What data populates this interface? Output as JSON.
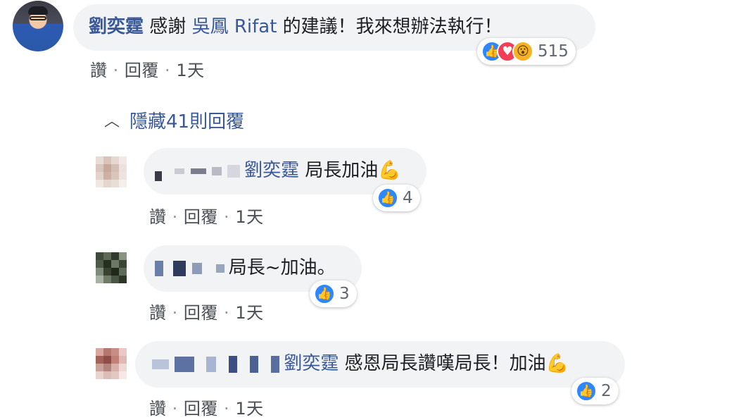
{
  "main_comment": {
    "author": "劉奕霆",
    "text_prefix": "感謝",
    "mention": "吳鳳 Rifat",
    "text_suffix": "的建議！我來想辦法執行！",
    "reactions": {
      "icons": [
        "like-icon",
        "love-icon",
        "wow-icon"
      ],
      "count": "515"
    },
    "actions": {
      "like": "讚",
      "reply": "回覆",
      "time": "1天"
    }
  },
  "hide_replies": {
    "label": "隱藏41則回覆",
    "icon": "chevron-up-icon"
  },
  "replies": [
    {
      "author_blurred": true,
      "mention": "劉奕霆",
      "text": "局長加油💪",
      "reaction_count": "4",
      "actions": {
        "like": "讚",
        "reply": "回覆",
        "time": "1天"
      }
    },
    {
      "author_blurred": true,
      "text": "局長~加油。",
      "reaction_count": "3",
      "actions": {
        "like": "讚",
        "reply": "回覆",
        "time": "1天"
      }
    },
    {
      "author_blurred": true,
      "mention": "劉奕霆",
      "text": "感恩局長讚嘆局長！加油💪",
      "reaction_count": "2",
      "actions": {
        "like": "讚",
        "reply": "回覆",
        "time": "1天"
      }
    }
  ],
  "colors": {
    "link": "#385898",
    "bubble": "#f2f3f5",
    "like_blue": "#2d88ff",
    "love_red": "#f33e58",
    "wow_yellow": "#f7b125",
    "meta_gray": "#4b4f56"
  }
}
